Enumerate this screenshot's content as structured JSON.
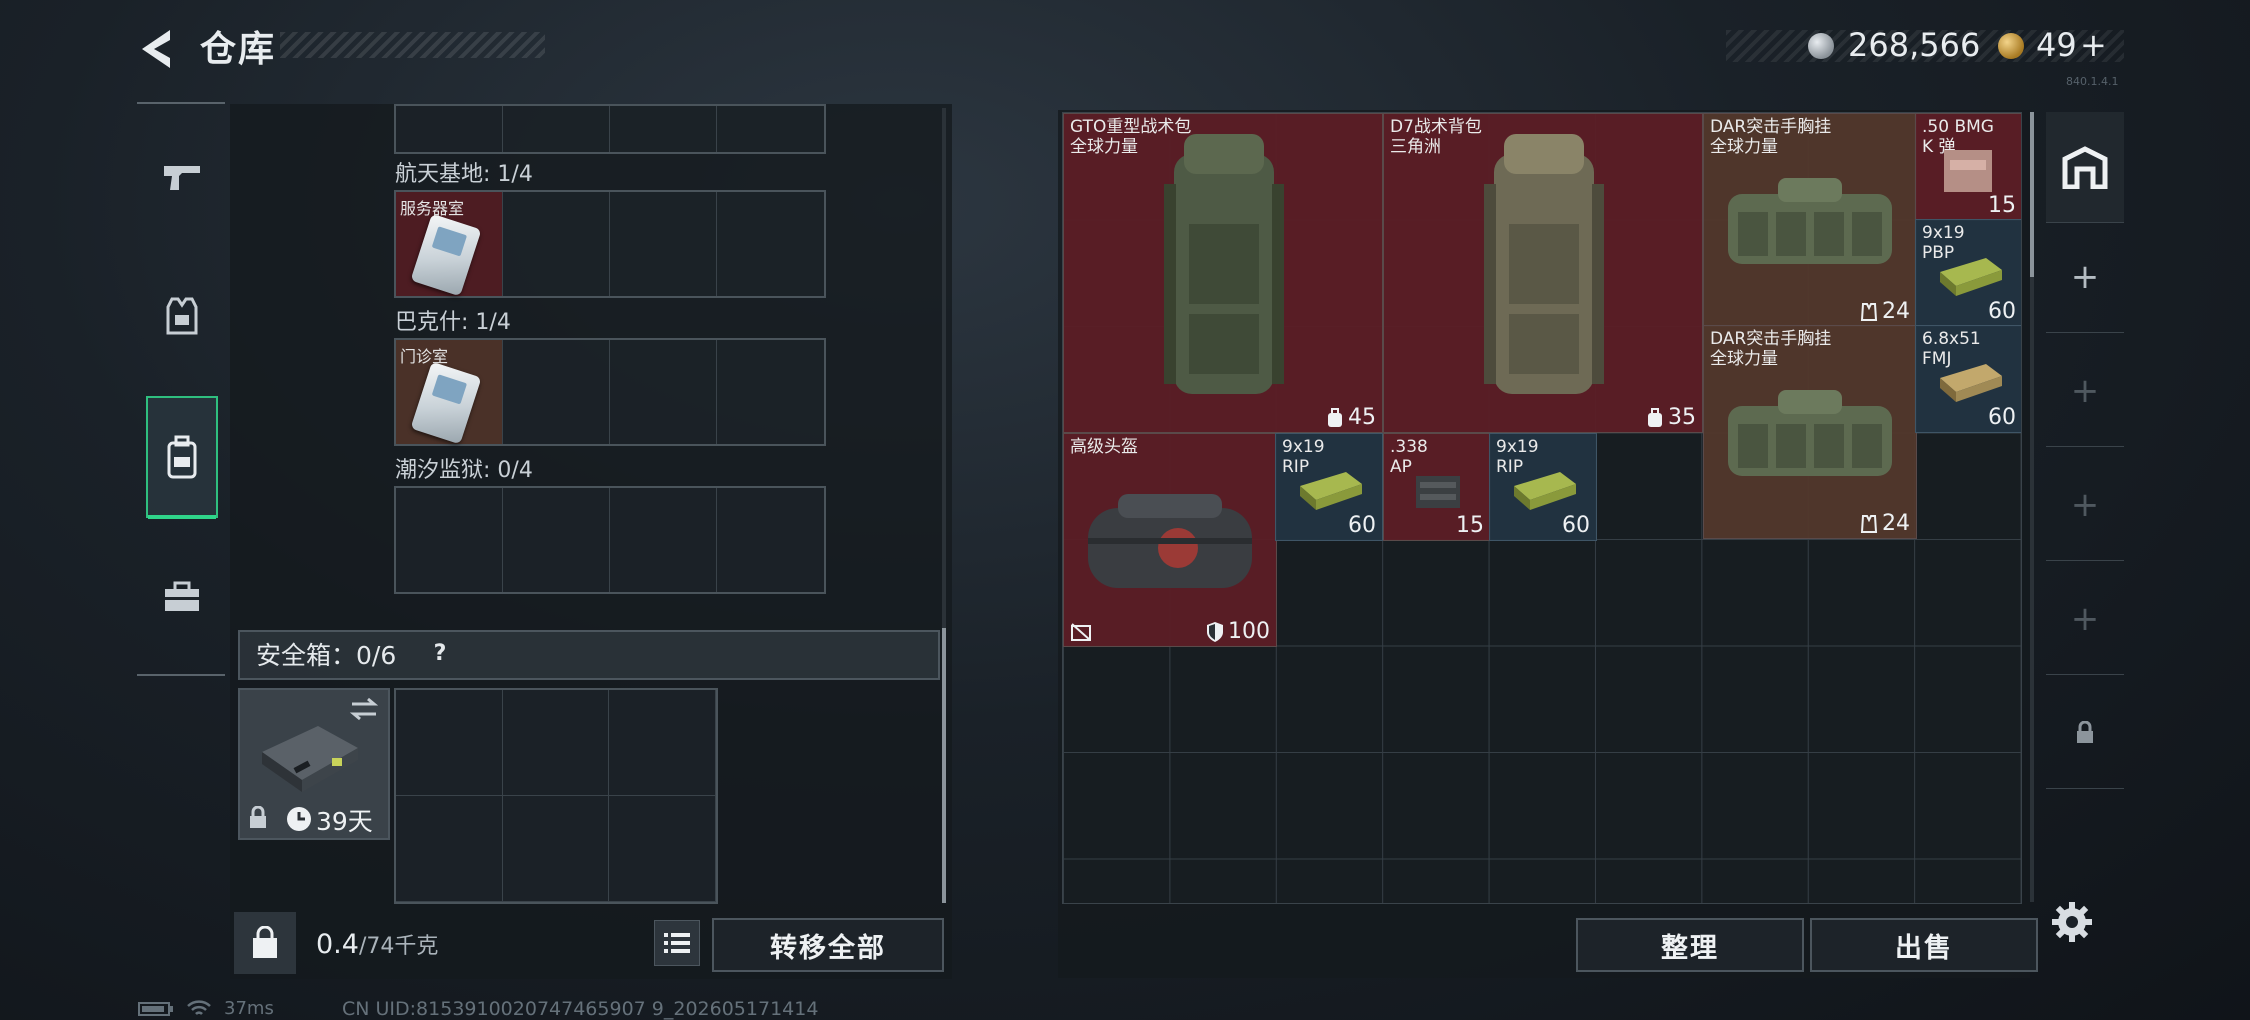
{
  "header": {
    "title": "仓库",
    "silver_amount": "268,566",
    "gold_amount": "49",
    "gold_plus": "+",
    "version": "840.1.4.1"
  },
  "left_tabs": [
    {
      "icon": "pistol-icon"
    },
    {
      "icon": "armor-vest-icon"
    },
    {
      "icon": "backpack-icon",
      "active": true
    },
    {
      "icon": "toolbox-icon"
    }
  ],
  "keycard_sections": [
    {
      "label": "航天基地: 1/4",
      "item": {
        "name": "服务器室",
        "color": "red"
      }
    },
    {
      "label": "巴克什: 1/4",
      "item": {
        "name": "门诊室",
        "color": "brown"
      }
    },
    {
      "label": "潮汐监狱: 0/4",
      "item": null
    }
  ],
  "safe_box": {
    "title": "安全箱：0/6",
    "help": "?",
    "days": "39天"
  },
  "bottom_left": {
    "weight": "0.4",
    "weight_max": "/74千克",
    "transfer_all": "转移全部"
  },
  "stash_items": [
    {
      "name": "GTO重型战术包\n全球力量",
      "stat": "45",
      "stat_icon": "capacity-icon",
      "color": "red"
    },
    {
      "name": "D7战术背包\n三角洲",
      "stat": "35",
      "stat_icon": "capacity-icon",
      "color": "red"
    },
    {
      "name": "DAR突击手胸挂\n全球力量",
      "stat": "24",
      "stat_icon": "vest-capacity-icon",
      "color": "brown"
    },
    {
      "name": ".50 BMG\nK 弹",
      "count": "15",
      "color": "red"
    },
    {
      "name": "9x19\nPBP",
      "count": "60",
      "color": "blue"
    },
    {
      "name": "DAR突击手胸挂\n全球力量",
      "stat": "24",
      "stat_icon": "vest-capacity-icon",
      "color": "brown"
    },
    {
      "name": "6.8x51\nFMJ",
      "count": "60",
      "color": "blue"
    },
    {
      "name": "高级头盔",
      "stat": "100",
      "stat_icon": "durability-icon",
      "color": "red"
    },
    {
      "name": "9x19\nRIP",
      "count": "60",
      "color": "blue"
    },
    {
      "name": ".338\nAP",
      "count": "15",
      "color": "red"
    },
    {
      "name": "9x19\nRIP",
      "count": "60",
      "color": "blue"
    }
  ],
  "right_buttons": {
    "sort": "整理",
    "sell": "出售"
  },
  "status": {
    "ping": "37ms",
    "uid": "CN UID:8153910020747465907 9_202605171414"
  }
}
